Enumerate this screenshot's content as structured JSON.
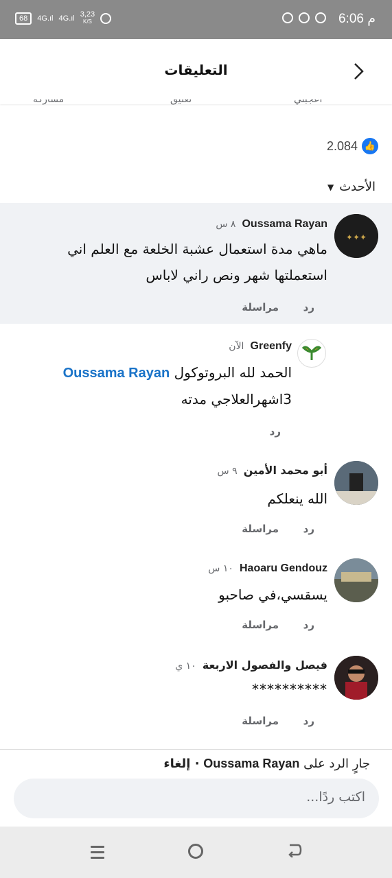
{
  "status_bar": {
    "time": "6:06 م",
    "battery": "68",
    "network_1": "4G",
    "network_2": "4G",
    "speed": "3,23",
    "speed_unit": "K/S"
  },
  "header": {
    "title": "التعليقات",
    "back_icon": "chevron-right"
  },
  "post_actions": {
    "share": "مشاركة",
    "comment": "تعليق",
    "like": "أعجبني"
  },
  "likes": {
    "count": "2.084",
    "icon": "thumbs-up",
    "color": "#1877f2"
  },
  "sort": {
    "label": "الأحدث"
  },
  "comments": [
    {
      "name": "Oussama Rayan",
      "time": "٨ س",
      "text_line1": "ماهي مدة استعمال عشبة الخلعة مع العلم اني",
      "text_line2": "استعملتها شهر ونص راني لاباس",
      "reply": "رد",
      "message": "مراسلة",
      "highlighted": true
    },
    {
      "name": "Greenfy",
      "time": "الآن",
      "mention": "Oussama Rayan",
      "text_line1": "الحمد لله البروتوكول",
      "text_line2": "3اشهرالعلاجي مدته",
      "reply": "رد"
    },
    {
      "name": "أبو محمد الأمين",
      "time": "٩ س",
      "text_line1": "الله ينعلكم",
      "reply": "رد",
      "message": "مراسلة"
    },
    {
      "name": "Haoaru Gendouz",
      "time": "١٠ س",
      "text_line1": "يسقسي،في صاحبو",
      "reply": "رد",
      "message": "مراسلة"
    },
    {
      "name": "فيصل والفصول الاربعة",
      "time": "١٠ ي",
      "text_line1": "**********",
      "reply": "رد",
      "message": "مراسلة"
    }
  ],
  "reply_bar": {
    "prefix": "جارٍ الرد على",
    "name": "Oussama Rayan",
    "cancel": "· إلغاء",
    "placeholder": "اكتب ردًا..."
  }
}
